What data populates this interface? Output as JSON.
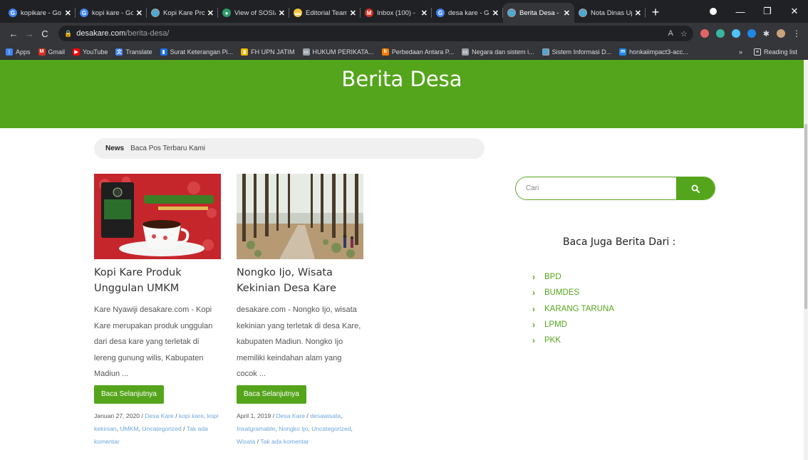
{
  "browser": {
    "tabs": [
      {
        "title": "kopikare - Go",
        "favicon_color": "#4285f4",
        "favicon": "G"
      },
      {
        "title": "kopi kare - Go",
        "favicon_color": "#4285f4",
        "favicon": "G"
      },
      {
        "title": "Kopi Kare Pro",
        "favicon_color": "#9aa0a6",
        "favicon": "🌐"
      },
      {
        "title": "View of SOSIA",
        "favicon_color": "#2e9b6a",
        "favicon": "●"
      },
      {
        "title": "Editorial Team",
        "favicon_color": "#f6c342",
        "favicon": "▬"
      },
      {
        "title": "Inbox (100) - ",
        "favicon_color": "#d93025",
        "favicon": "M"
      },
      {
        "title": "desa kare - Go",
        "favicon_color": "#4285f4",
        "favicon": "G"
      },
      {
        "title": "Berita Desa -",
        "favicon_color": "#9aa0a6",
        "favicon": "🌐"
      },
      {
        "title": "Nota Dinas Up",
        "favicon_color": "#9aa0a6",
        "favicon": "🌐"
      }
    ],
    "new_tab": "+",
    "address": {
      "host": "desakare.com",
      "path": "/berita-desa/"
    },
    "bookmarks": [
      {
        "label": "Apps",
        "color": "#4285f4",
        "icon": "⋮"
      },
      {
        "label": "Gmail",
        "color": "#d93025",
        "icon": "M"
      },
      {
        "label": "YouTube",
        "color": "#ff0000",
        "icon": "▶"
      },
      {
        "label": "Translate",
        "color": "#4285f4",
        "icon": "文"
      },
      {
        "label": "Surat Keterangan Pi...",
        "color": "#1a73e8",
        "icon": "▮"
      },
      {
        "label": "FH UPN JATIM",
        "color": "#f2b705",
        "icon": "▮"
      },
      {
        "label": "HUKUM PERIKATA...",
        "color": "#9aa0a6",
        "icon": "▭"
      },
      {
        "label": "Perbedaan Antara P...",
        "color": "#f57c00",
        "icon": "b"
      },
      {
        "label": "Negara dan sistem i...",
        "color": "#9aa0a6",
        "icon": "▭"
      },
      {
        "label": "Sistem Informasi D...",
        "color": "#9aa0a6",
        "icon": "🌐"
      },
      {
        "label": "honkaiimpact3-acc...",
        "color": "#1e88e5",
        "icon": "m"
      }
    ],
    "more_bookmarks": "»",
    "reading_list": "Reading list"
  },
  "page": {
    "title": "Berita Desa",
    "breadcrumb": {
      "label": "News",
      "text": "Baca Pos Terbaru Kami"
    },
    "read_more_label": "Baca Selanjutnya",
    "posts": [
      {
        "title": "Kopi Kare Produk Unggulan UMKM",
        "excerpt": "Kare Nyawiji desakare.com - Kopi Kare merupakan produk unggulan dari desa kare yang terletak di lereng gunung wilis, Kabupaten Madiun ...",
        "date": "Januari 27, 2020",
        "tags": [
          "Desa Kare",
          "kopi kare",
          "kopi kekinian",
          "UMKM",
          "Uncategorized"
        ],
        "comments": "Tak ada komentar"
      },
      {
        "title": "Nongko Ijo, Wisata Kekinian Desa Kare",
        "excerpt": "desakare.com - Nongko Ijo, wisata kekinian yang terletak di desa Kare, kabupaten Madiun. Nongko Ijo memiliki keindahan alam yang cocok ...",
        "date": "April 1, 2019",
        "tags": [
          "Desa Kare",
          "desawisata",
          "Insatgramable",
          "Nongko Ijo",
          "Uncategorized",
          "Wisata"
        ],
        "comments": "Tak ada komentar"
      }
    ],
    "search": {
      "placeholder": "Cari"
    },
    "sidebar": {
      "title": "Baca Juga Berita Dari :",
      "items": [
        "BPD",
        "BUMDES",
        "KARANG TARUNA",
        "LPMD",
        "PKK"
      ]
    },
    "colors": {
      "accent": "#55a51c",
      "link": "#6fa8dc"
    }
  }
}
